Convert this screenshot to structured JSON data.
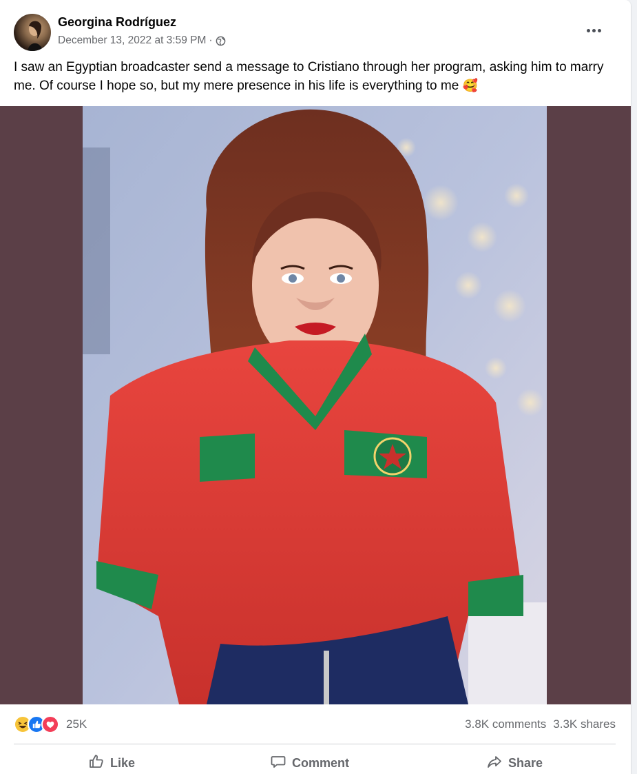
{
  "post": {
    "author": "Georgina Rodríguez",
    "date": "December 13, 2022 at 3:59 PM",
    "separator": "·",
    "privacy_icon": "globe-icon",
    "more_icon": "more-options-icon",
    "text": "I saw an Egyptian broadcaster send a message to Cristiano through her program, asking him to marry me. Of course I hope so, but my mere presence in his life is everything to me",
    "text_emoji": "🥰",
    "media_background": "#5b3f47"
  },
  "engagement": {
    "reactions": [
      "haha",
      "like",
      "love"
    ],
    "reaction_count": "25K",
    "comments": "3.8K comments",
    "shares": "3.3K shares"
  },
  "actions": {
    "like": "Like",
    "comment": "Comment",
    "share": "Share"
  }
}
